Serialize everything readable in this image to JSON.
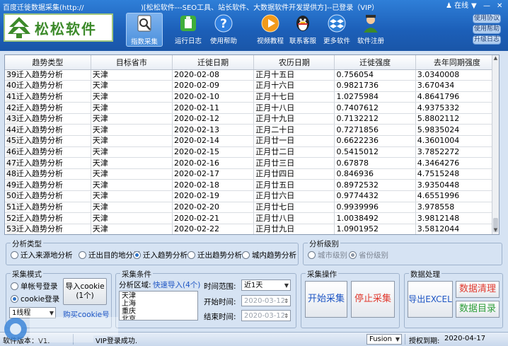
{
  "app": {
    "title_left": "百度迁徙数据采集(http://",
    "title_right": ")[松松软件---SEO工具、站长软件、大数据软件开发提供方]--已登录（VIP）",
    "online": "在线",
    "logo_text": "松松软件",
    "colors": {
      "header": "#1c5fb8",
      "accent": "#2c72c7",
      "red_btn": "#e03a2f",
      "green_btn": "#2f9e3a"
    }
  },
  "toolbar": [
    {
      "label": "指数采集",
      "icon": "search-doc-icon"
    },
    {
      "label": "运行日志",
      "icon": "log-icon"
    },
    {
      "label": "使用帮助",
      "icon": "help-icon"
    },
    {
      "label": "视频教程",
      "icon": "play-icon"
    },
    {
      "label": "联系客服",
      "icon": "qq-penguin-icon"
    },
    {
      "label": "更多软件",
      "icon": "dropbox-icon"
    },
    {
      "label": "软件注册",
      "icon": "user-icon"
    }
  ],
  "side_buttons": [
    "使用协议",
    "使用帮助",
    "升级日志"
  ],
  "table": {
    "headers": [
      "趋势类型",
      "目标省市",
      "迁徙日期",
      "农历日期",
      "迁徙强度",
      "去年同期强度"
    ],
    "rows": [
      {
        "n": "39",
        "c": [
          "迁入趋势分析",
          "天津",
          "2020-02-08",
          "正月十五日",
          "0.756054",
          "3.0340008"
        ]
      },
      {
        "n": "40",
        "c": [
          "迁入趋势分析",
          "天津",
          "2020-02-09",
          "正月十六日",
          "0.9821736",
          "3.670434"
        ]
      },
      {
        "n": "41",
        "c": [
          "迁入趋势分析",
          "天津",
          "2020-02-10",
          "正月十七日",
          "1.0275984",
          "4.8641796"
        ]
      },
      {
        "n": "42",
        "c": [
          "迁入趋势分析",
          "天津",
          "2020-02-11",
          "正月十八日",
          "0.7407612",
          "4.9375332"
        ]
      },
      {
        "n": "43",
        "c": [
          "迁入趋势分析",
          "天津",
          "2020-02-12",
          "正月十九日",
          "0.7132212",
          "5.8802112"
        ]
      },
      {
        "n": "44",
        "c": [
          "迁入趋势分析",
          "天津",
          "2020-02-13",
          "正月二十日",
          "0.7271856",
          "5.9835024"
        ]
      },
      {
        "n": "45",
        "c": [
          "迁入趋势分析",
          "天津",
          "2020-02-14",
          "正月廿一日",
          "0.6622236",
          "4.3601004"
        ]
      },
      {
        "n": "46",
        "c": [
          "迁入趋势分析",
          "天津",
          "2020-02-15",
          "正月廿二日",
          "0.5415012",
          "3.7852272"
        ]
      },
      {
        "n": "47",
        "c": [
          "迁入趋势分析",
          "天津",
          "2020-02-16",
          "正月廿三日",
          "0.67878",
          "4.3464276"
        ]
      },
      {
        "n": "48",
        "c": [
          "迁入趋势分析",
          "天津",
          "2020-02-17",
          "正月廿四日",
          "0.846936",
          "4.7515248"
        ]
      },
      {
        "n": "49",
        "c": [
          "迁入趋势分析",
          "天津",
          "2020-02-18",
          "正月廿五日",
          "0.8972532",
          "3.9350448"
        ]
      },
      {
        "n": "50",
        "c": [
          "迁入趋势分析",
          "天津",
          "2020-02-19",
          "正月廿六日",
          "0.9774432",
          "4.6551996"
        ]
      },
      {
        "n": "51",
        "c": [
          "迁入趋势分析",
          "天津",
          "2020-02-20",
          "正月廿七日",
          "0.9939996",
          "3.978558"
        ]
      },
      {
        "n": "52",
        "c": [
          "迁入趋势分析",
          "天津",
          "2020-02-21",
          "正月廿八日",
          "1.0038492",
          "3.9812148"
        ]
      },
      {
        "n": "53",
        "c": [
          "迁入趋势分析",
          "天津",
          "2020-02-22",
          "正月廿九日",
          "1.0901952",
          "3.5812044"
        ]
      }
    ]
  },
  "analysis_type": {
    "title": "分析类型",
    "options": [
      "迁入来源地分析",
      "迁出目的地分析",
      "迁入趋势分析",
      "迁出趋势分析",
      "城内趋势分析"
    ],
    "selected": "迁入趋势分析"
  },
  "analysis_level": {
    "title": "分析级别",
    "options": [
      "城市级别",
      "省份级别"
    ],
    "selected": "省份级别"
  },
  "collect_mode": {
    "title": "采集模式",
    "options": [
      "单帐号登录",
      "cookie登录"
    ],
    "selected": "cookie登录",
    "import_label": "导入cookie",
    "import_count": "(1个)",
    "thread_value": "1线程",
    "buy_cookie": "购买cookie号"
  },
  "collect_cond": {
    "title": "采集条件",
    "region_label": "分析区域:",
    "quick_import": "快速导入(4个)",
    "regions": [
      "天津",
      "上海",
      "重庆",
      "北京"
    ],
    "range_label": "时间范围:",
    "range_value": "近1天",
    "start_label": "开始时间:",
    "start_value": "2020-03-12",
    "end_label": "结束时间:",
    "end_value": "2020-03-12"
  },
  "collect_ops": {
    "title": "采集操作",
    "start": "开始采集",
    "stop": "停止采集"
  },
  "data_proc": {
    "title": "数据处理",
    "export": "导出EXCEL",
    "clean": "数据清理",
    "catalog": "数据目录"
  },
  "status": {
    "version": "软件版本：V1.",
    "message": "VIP登录成功.",
    "theme": "Fusion",
    "expire_label": "授权到期:",
    "expire_value": "2020-04-17"
  }
}
